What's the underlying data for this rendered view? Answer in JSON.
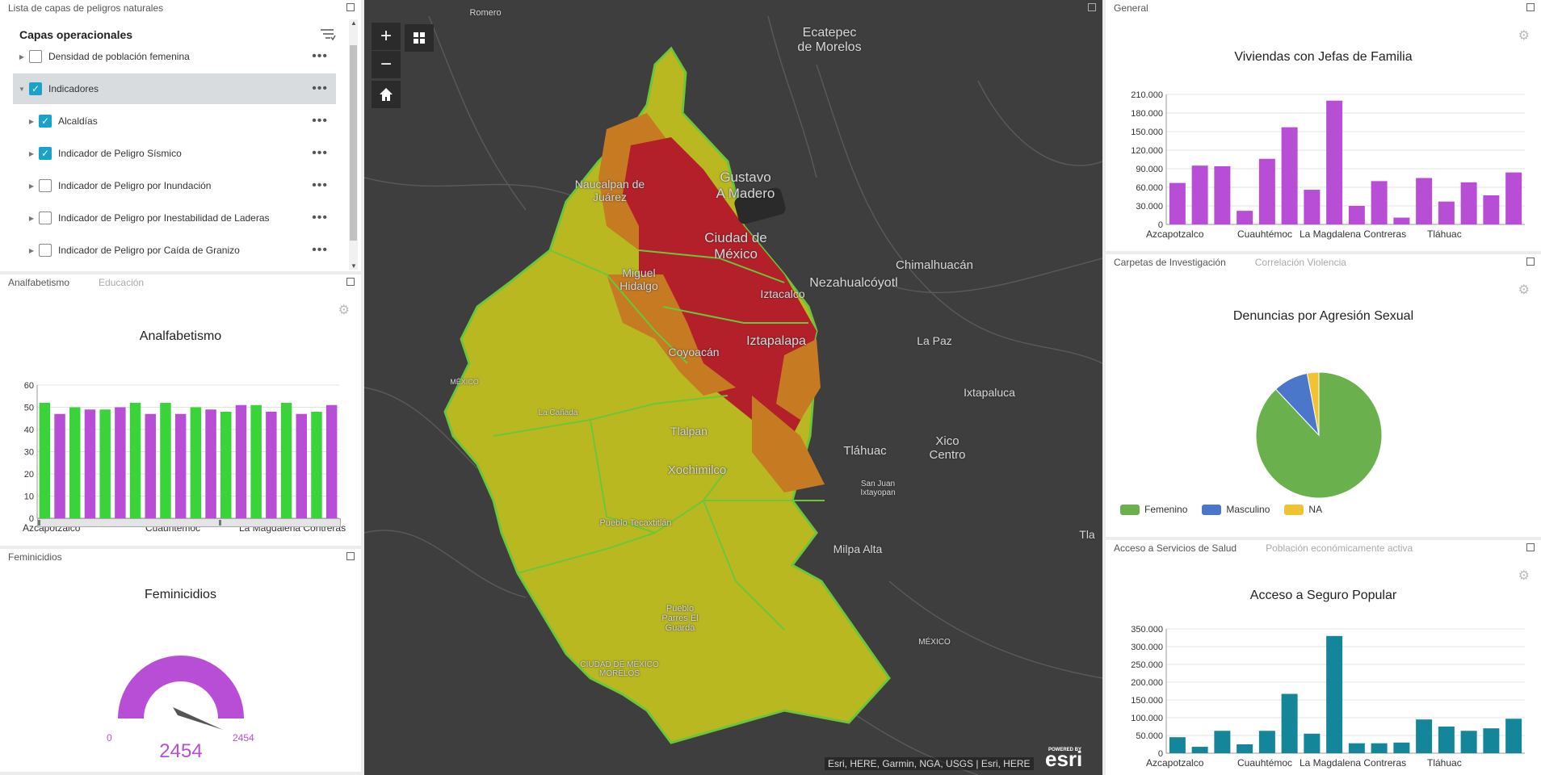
{
  "layer_list": {
    "panel_title": "Lista de capas de peligros naturales",
    "heading": "Capas operacionales",
    "items": [
      {
        "label": "Densidad de población femenina",
        "checked": false,
        "expanded": false
      },
      {
        "label": "Indicadores",
        "checked": true,
        "expanded": true
      },
      {
        "label": "Alcaldías",
        "checked": true,
        "expanded": false
      },
      {
        "label": "Indicador de Peligro Sísmico",
        "checked": true,
        "expanded": false
      },
      {
        "label": "Indicador de Peligro por Inundación",
        "checked": false,
        "expanded": false
      },
      {
        "label": "Indicador de Peligro por Inestabilidad de Laderas",
        "checked": false,
        "expanded": false
      },
      {
        "label": "Indicador de Peligro por Caída de Granizo",
        "checked": false,
        "expanded": false
      }
    ]
  },
  "analfabetismo_panel": {
    "tabs": [
      "Analfabetismo",
      "Educación"
    ],
    "chart_data": {
      "type": "bar",
      "title": "Analfabetismo",
      "ylim": [
        0,
        60
      ],
      "yticks": [
        "0",
        "10",
        "20",
        "30",
        "40",
        "50",
        "60"
      ],
      "xtick_labels": [
        "Azcapotzalco",
        "Cuauhtémoc",
        "La Magdalena Contreras"
      ],
      "series": [
        {
          "color": "#3ad33a",
          "values": [
            52,
            50,
            49,
            52,
            52,
            50,
            48,
            51,
            52,
            48
          ]
        },
        {
          "color": "#b84ed6",
          "values": [
            47,
            49,
            50,
            47,
            47,
            49,
            51,
            48,
            47,
            51
          ]
        }
      ]
    }
  },
  "feminicidios_panel": {
    "panel_title": "Feminicidios",
    "chart_data": {
      "type": "gauge",
      "title": "Feminicidios",
      "min": 0,
      "max": 2454,
      "value": 2454,
      "min_label": "0",
      "max_label": "2454",
      "value_label": "2454",
      "color": "#b84ed6"
    }
  },
  "map": {
    "attribution": "Esri, HERE, Garmin, NGA, USGS | Esri, HERE",
    "powered_by": "POWERED BY",
    "brand": "esri",
    "zoom_in": "+",
    "zoom_out": "−",
    "labels": [
      {
        "text": "Romero"
      },
      {
        "text": "Ecatepec\nde Morelos"
      },
      {
        "text": "Naucalpan de\nJuárez"
      },
      {
        "text": "Gustavo\nA Madero"
      },
      {
        "text": "Ciudad de\nMéxico"
      },
      {
        "text": "Chimalhuacán"
      },
      {
        "text": "Miguel\nHidalgo"
      },
      {
        "text": "Nezahualcóyotl"
      },
      {
        "text": "Iztacalco"
      },
      {
        "text": "Coyoacán"
      },
      {
        "text": "Iztapalapa"
      },
      {
        "text": "La Paz"
      },
      {
        "text": "Ixtapaluca"
      },
      {
        "text": "La Cañada"
      },
      {
        "text": "Tlalpan"
      },
      {
        "text": "Xico\nCentro"
      },
      {
        "text": "Tláhuac"
      },
      {
        "text": "Xochimilco"
      },
      {
        "text": "San Juan\nIxtayopan"
      },
      {
        "text": "Pueblo Tecaxtitlán"
      },
      {
        "text": "Milpa Alta"
      },
      {
        "text": "Pueblo\nParres El\nGuarda"
      },
      {
        "text": "CIUDAD DE MÉXICO\nMORELOS"
      },
      {
        "text": "MÉXICO"
      },
      {
        "text": "MÉXICO"
      },
      {
        "text": "Tla"
      }
    ]
  },
  "general_panel": {
    "panel_title": "General",
    "chart_data": {
      "type": "bar",
      "title": "Viviendas con Jefas de Familia",
      "ylim": [
        0,
        210000
      ],
      "yticks": [
        "0",
        "30.000",
        "60.000",
        "90.000",
        "120.000",
        "150.000",
        "180.000",
        "210.000"
      ],
      "xtick_labels": [
        "Azcapotzalco",
        "Cuauhtémoc",
        "La Magdalena Contreras",
        "Tláhuac"
      ],
      "color": "#b84ed6",
      "values": [
        67000,
        95000,
        94000,
        22000,
        106000,
        157000,
        56000,
        200000,
        30000,
        70000,
        11000,
        75000,
        37000,
        68000,
        47000,
        84000
      ]
    }
  },
  "carpetas_panel": {
    "tabs": [
      "Carpetas de Investigación",
      "Correlación Violencia"
    ],
    "chart_data": {
      "type": "pie",
      "title": "Denuncias por Agresión Sexual",
      "slices": [
        {
          "label": "Femenino",
          "value": 0.88,
          "color": "#6ab04c"
        },
        {
          "label": "Masculino",
          "value": 0.09,
          "color": "#4a77c9"
        },
        {
          "label": "NA",
          "value": 0.03,
          "color": "#f1c232"
        }
      ]
    }
  },
  "salud_panel": {
    "tabs": [
      "Acceso a Servicios de Salud",
      "Población económicamente activa"
    ],
    "chart_data": {
      "type": "bar",
      "title": "Acceso a Seguro Popular",
      "ylim": [
        0,
        350000
      ],
      "yticks": [
        "0",
        "50.000",
        "100.000",
        "150.000",
        "200.000",
        "250.000",
        "300.000",
        "350.000"
      ],
      "xtick_labels": [
        "Azcapotzalco",
        "Cuauhtémoc",
        "La Magdalena Contreras",
        "Tláhuac"
      ],
      "color": "#13869a",
      "values": [
        45000,
        18000,
        63000,
        25000,
        63000,
        167000,
        55000,
        330000,
        28000,
        28000,
        30000,
        95000,
        75000,
        63000,
        70000,
        97000
      ]
    }
  }
}
